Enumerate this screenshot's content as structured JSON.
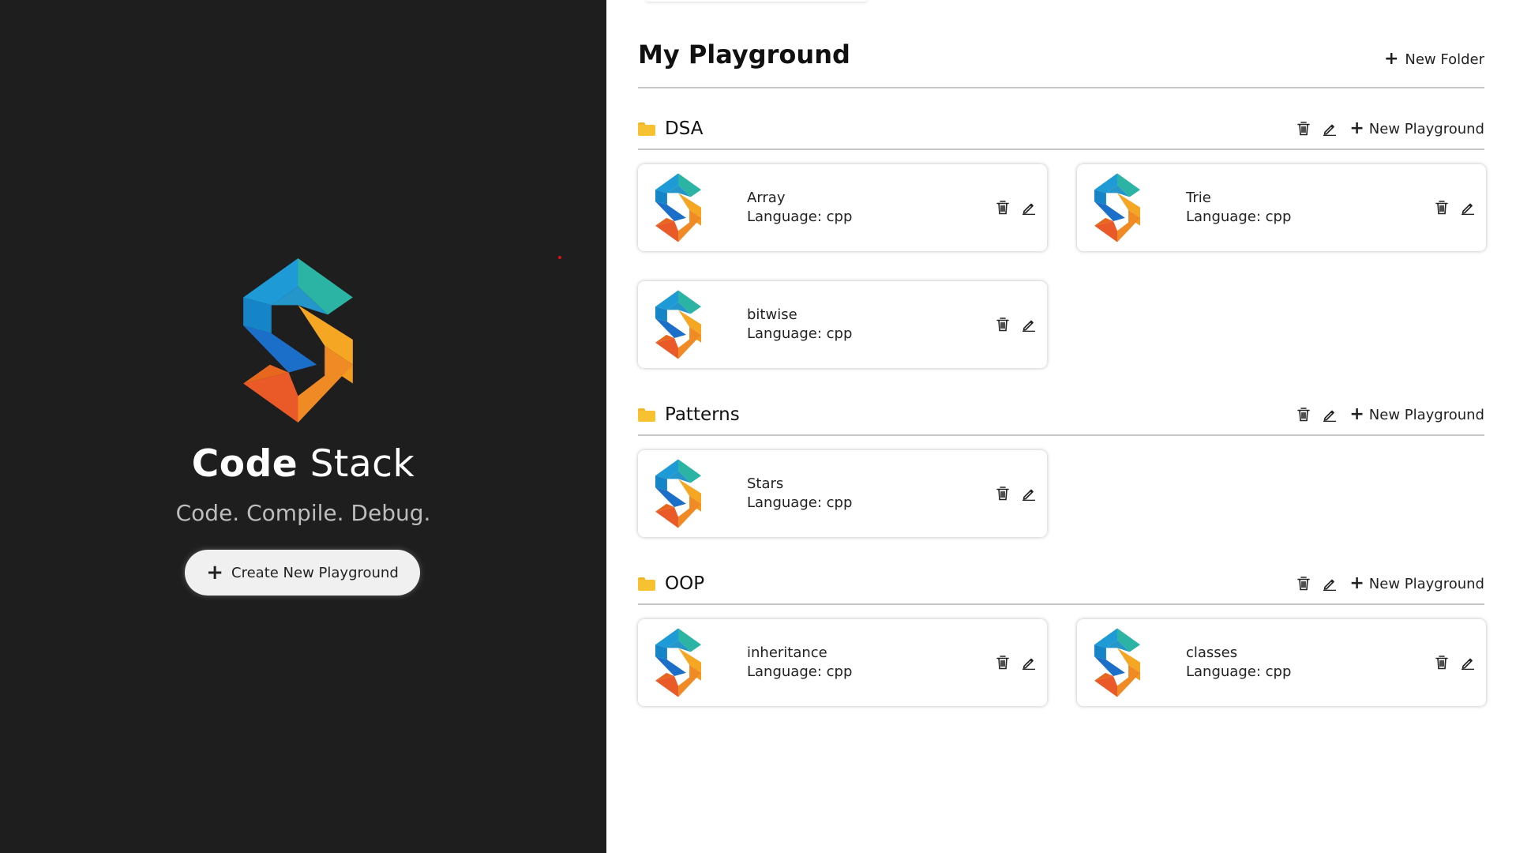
{
  "sidebar": {
    "brand_bold": "Code",
    "brand_light": "Stack",
    "tagline": "Code. Compile. Debug.",
    "create_button_label": "Create New Playground"
  },
  "main": {
    "title_light": "My",
    "title_bold": "Playground",
    "new_folder_label": "New Folder",
    "new_playground_label": "New Playground",
    "folders": [
      {
        "name": "DSA",
        "cards": [
          {
            "title": "Array",
            "language": "Language: cpp"
          },
          {
            "title": "Trie",
            "language": "Language: cpp"
          },
          {
            "title": "bitwise",
            "language": "Language: cpp"
          }
        ]
      },
      {
        "name": "Patterns",
        "cards": [
          {
            "title": "Stars",
            "language": "Language: cpp"
          }
        ]
      },
      {
        "name": "OOP",
        "cards": [
          {
            "title": "inheritance",
            "language": "Language: cpp"
          },
          {
            "title": "classes",
            "language": "Language: cpp"
          }
        ]
      }
    ]
  },
  "icons": {
    "folder": "folder-icon",
    "delete": "trash-icon",
    "edit": "pencil-icon",
    "add": "plus-icon"
  },
  "colors": {
    "sidebar_bg": "#1e1e1e",
    "folder_yellow": "#f7c232",
    "logo_teal": "#2bb3a4",
    "logo_blue": "#1c7fd1",
    "logo_orange": "#f5a623",
    "logo_red": "#ea5a28"
  }
}
